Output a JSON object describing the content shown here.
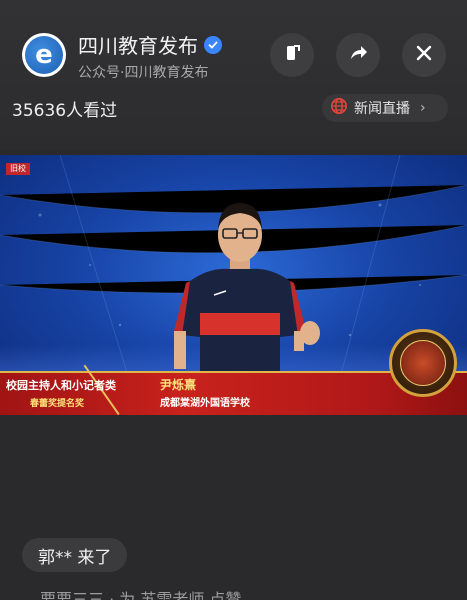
{
  "account": {
    "name": "四川教育发布",
    "subtitle": "公众号·四川教育发布",
    "avatar_letter": "e"
  },
  "views_text": "35636人看过",
  "live_button_label": "新闻直播",
  "video": {
    "corner_tag": "旧校",
    "lower_third": {
      "category": "校园主持人和小记者类",
      "award": "春蕾奖提名奖",
      "name": "尹烁熹",
      "school": "成都棠湖外国语学校"
    }
  },
  "chat": {
    "message": "郭** 来了",
    "next_partial": "要要三三 · 为 苏雷老师 点赞"
  },
  "colors": {
    "background": "#2a2a2c",
    "verified": "#3a86ff",
    "lower_third_red": "#c8221c",
    "gold": "#e0b64a"
  }
}
